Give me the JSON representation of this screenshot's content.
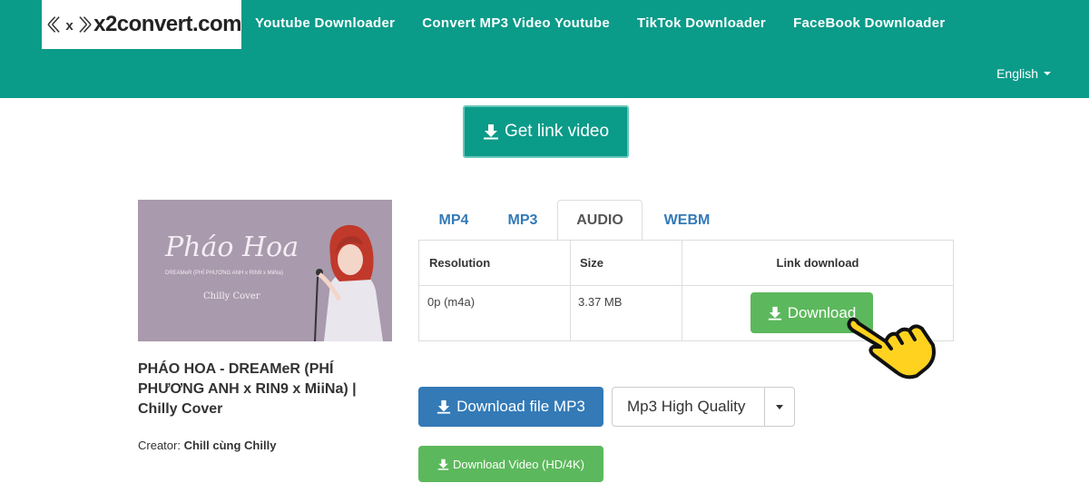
{
  "header": {
    "logo_text": "x2convert.com",
    "logo_mark_letter": "x",
    "nav": [
      "Youtube Downloader",
      "Convert MP3 Video Youtube",
      "TikTok Downloader",
      "FaceBook Downloader"
    ],
    "language": "English"
  },
  "get_link_label": "Get link video",
  "video": {
    "thumbnail": {
      "script_title": "Pháo Hoa",
      "credits": "DREAMeR (PHÍ PHƯƠNG ANH x RIN9 x MiiNa)",
      "cover": "Chilly Cover"
    },
    "title": "PHÁO HOA - DREAMeR (PHÍ PHƯƠNG ANH x RIN9 x MiiNa) | Chilly Cover",
    "creator_label": "Creator:",
    "creator_name": "Chill cùng Chilly"
  },
  "tabs": [
    {
      "label": "MP4",
      "active": false
    },
    {
      "label": "MP3",
      "active": false
    },
    {
      "label": "AUDIO",
      "active": true
    },
    {
      "label": "WEBM",
      "active": false
    }
  ],
  "table": {
    "headers": [
      "Resolution",
      "Size",
      "Link download"
    ],
    "rows": [
      {
        "resolution": "0p (m4a)",
        "size": "3.37 MB",
        "download_label": "Download"
      }
    ]
  },
  "actions": {
    "download_mp3_label": "Download file MP3",
    "quality_selected": "Mp3 High Quality",
    "download_video_label": "Download Video (HD/4K)"
  },
  "colors": {
    "brand_teal": "#0b9b89",
    "primary_blue": "#337ab7",
    "success_green": "#5cb85c",
    "link_blue": "#337ab7"
  },
  "icons": {
    "download": "download-icon",
    "cursor": "hand-pointer-icon"
  }
}
